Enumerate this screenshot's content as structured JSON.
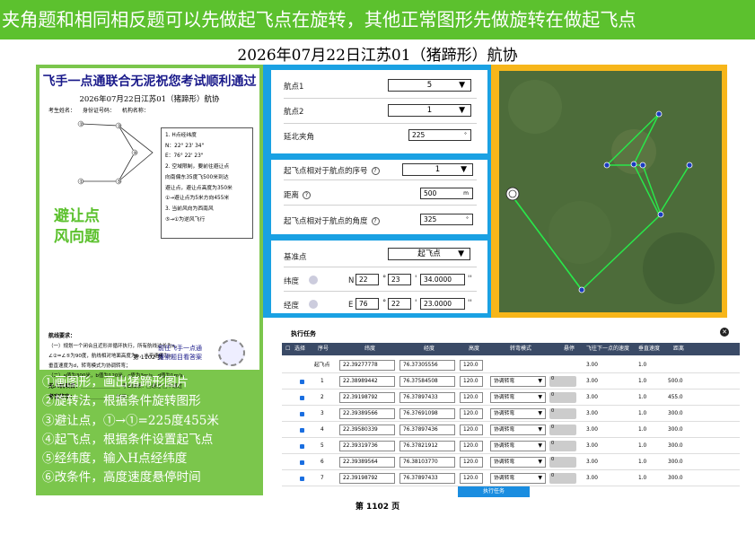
{
  "banner": "夹角题和相同相反题可以先做起飞点在旋转，其他正常图形先做旋转在做起飞点",
  "title": "2026年07月22日江苏01（猪蹄形）航协",
  "paper": {
    "heading": "飞手一点通联合无泥祝您考试顺利通过",
    "sub": "2026年07月22日江苏01（猪蹄形）航协",
    "fields": [
      "考生姓名：",
      "身份证号码：",
      "机构名称："
    ],
    "notes": [
      "1. H点经纬度",
      "N：22° 23' 34\"",
      "E：76° 22' 23\"",
      "2. 空域限制，要前往避让点",
      "向南偏东35度飞500米到达",
      "避让点，避让点高度为350米",
      "①→避让点为5米方向455米",
      "3. 当前风向为西南风",
      "⑤→①为逆风飞行"
    ],
    "big1": "避让点",
    "big2": "风向题",
    "req_title": "航线要求：",
    "req_lines": [
      "（一）规划一个闭合且近形并循环执行，所有航线边长为a，",
      "∠②=∠⑤为90度，航线相对地面高度为b，水平速度为c，",
      "垂直速度为d，转弯模式为协调转弯；",
      "（二）a值为300米，b值为120米，c值为3m/s，d值为1m/s。"
    ],
    "sig1": "无人机项目：",
    "sig1b": "考试成绩：□通过 □不通过",
    "sig2": "考官签字：",
    "sig2b": "时间：",
    "footer": "第 1102 页",
    "logo1": "前往飞手一点通",
    "logo2": "搜索题目看答案"
  },
  "steps": [
    "①画图形，画出猪蹄形图片",
    "②旋转法，根据条件旋转图形",
    "③避让点，①→①=225度455米",
    "④起飞点，根据条件设置起飞点",
    "⑤经纬度，输入H点经纬度",
    "⑥改条件，高度速度悬停时间"
  ],
  "form1": {
    "l1": "航点1",
    "v1": "5",
    "l2": "航点2",
    "v2": "1",
    "l3": "延北夹角",
    "v3": "225",
    "u3": "°"
  },
  "form2": {
    "l1": "起飞点相对于航点的序号",
    "v1": "1",
    "l2": "距离",
    "v2": "500",
    "u2": "m",
    "l3": "起飞点相对于航点的角度",
    "v3": "325",
    "u3": "°"
  },
  "form3": {
    "l1": "基准点",
    "v1": "起飞点",
    "lat_label": "纬度",
    "lat_dir": "N",
    "lat_d": "22",
    "lat_m": "23",
    "lat_s": "34.0000",
    "lng_label": "经度",
    "lng_dir": "E",
    "lng_d": "76",
    "lng_m": "22",
    "lng_s": "23.0000",
    "deg": "°",
    "min": "'",
    "sec": "''"
  },
  "exec": {
    "title": "执行任务",
    "headers": [
      "选择",
      "序号",
      "纬度",
      "经度",
      "高度",
      "转弯模式",
      "悬停",
      "飞往下一点的速度",
      "垂直速度",
      "距离"
    ],
    "takeoff": {
      "label": "起飞点",
      "lat": "22.39277778",
      "lng": "76.37305556",
      "alt": "120.0",
      "speed": "3.00",
      "vspeed": "1.0"
    },
    "rows": [
      {
        "n": "1",
        "lat": "22.38989442",
        "lng": "76.37584508",
        "alt": "120.0",
        "mode": "协调转弯",
        "hover": "0",
        "speed": "3.00",
        "vspeed": "1.0",
        "dist": "500.0"
      },
      {
        "n": "2",
        "lat": "22.39198792",
        "lng": "76.37897433",
        "alt": "120.0",
        "mode": "协调转弯",
        "hover": "0",
        "speed": "3.00",
        "vspeed": "1.0",
        "dist": "455.0"
      },
      {
        "n": "3",
        "lat": "22.39389566",
        "lng": "76.37691098",
        "alt": "120.0",
        "mode": "协调转弯",
        "hover": "0",
        "speed": "3.00",
        "vspeed": "1.0",
        "dist": "300.0"
      },
      {
        "n": "4",
        "lat": "22.39580339",
        "lng": "76.37897436",
        "alt": "120.0",
        "mode": "协调转弯",
        "hover": "0",
        "speed": "3.00",
        "vspeed": "1.0",
        "dist": "300.0"
      },
      {
        "n": "5",
        "lat": "22.39319736",
        "lng": "76.37821912",
        "alt": "120.0",
        "mode": "协调转弯",
        "hover": "0",
        "speed": "3.00",
        "vspeed": "1.0",
        "dist": "300.0"
      },
      {
        "n": "6",
        "lat": "22.39389564",
        "lng": "76.38103770",
        "alt": "120.0",
        "mode": "协调转弯",
        "hover": "0",
        "speed": "3.00",
        "vspeed": "1.0",
        "dist": "300.0"
      },
      {
        "n": "7",
        "lat": "22.39198792",
        "lng": "76.37897433",
        "alt": "120.0",
        "mode": "协调转弯",
        "hover": "0",
        "speed": "3.00",
        "vspeed": "1.0",
        "dist": "300.0"
      }
    ],
    "button": "执行任务"
  },
  "page": "第 1102 页",
  "icons": {
    "dropdown": "caret-down-icon",
    "help": "question-circle-icon",
    "close": "close-circle-icon"
  }
}
